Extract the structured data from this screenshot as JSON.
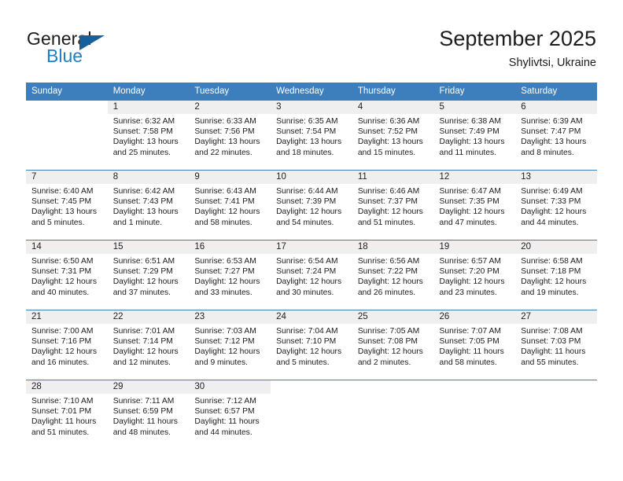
{
  "brand": {
    "name_part1": "General",
    "name_part2": "Blue",
    "logo_icon": "triangle-icon"
  },
  "header": {
    "title": "September 2025",
    "subtitle": "Shylivtsi, Ukraine"
  },
  "colors": {
    "header_blue": "#3d7ebc",
    "brand_blue": "#1e7fc4",
    "logo_blue": "#15619e",
    "number_band": "#efefef",
    "text": "#1c1c1c"
  },
  "weekday_headers": [
    "Sunday",
    "Monday",
    "Tuesday",
    "Wednesday",
    "Thursday",
    "Friday",
    "Saturday"
  ],
  "weeks": [
    [
      {
        "day": "",
        "lines": []
      },
      {
        "day": "1",
        "lines": [
          "Sunrise: 6:32 AM",
          "Sunset: 7:58 PM",
          "Daylight: 13 hours",
          "and 25 minutes."
        ]
      },
      {
        "day": "2",
        "lines": [
          "Sunrise: 6:33 AM",
          "Sunset: 7:56 PM",
          "Daylight: 13 hours",
          "and 22 minutes."
        ]
      },
      {
        "day": "3",
        "lines": [
          "Sunrise: 6:35 AM",
          "Sunset: 7:54 PM",
          "Daylight: 13 hours",
          "and 18 minutes."
        ]
      },
      {
        "day": "4",
        "lines": [
          "Sunrise: 6:36 AM",
          "Sunset: 7:52 PM",
          "Daylight: 13 hours",
          "and 15 minutes."
        ]
      },
      {
        "day": "5",
        "lines": [
          "Sunrise: 6:38 AM",
          "Sunset: 7:49 PM",
          "Daylight: 13 hours",
          "and 11 minutes."
        ]
      },
      {
        "day": "6",
        "lines": [
          "Sunrise: 6:39 AM",
          "Sunset: 7:47 PM",
          "Daylight: 13 hours",
          "and 8 minutes."
        ]
      }
    ],
    [
      {
        "day": "7",
        "lines": [
          "Sunrise: 6:40 AM",
          "Sunset: 7:45 PM",
          "Daylight: 13 hours",
          "and 5 minutes."
        ]
      },
      {
        "day": "8",
        "lines": [
          "Sunrise: 6:42 AM",
          "Sunset: 7:43 PM",
          "Daylight: 13 hours",
          "and 1 minute."
        ]
      },
      {
        "day": "9",
        "lines": [
          "Sunrise: 6:43 AM",
          "Sunset: 7:41 PM",
          "Daylight: 12 hours",
          "and 58 minutes."
        ]
      },
      {
        "day": "10",
        "lines": [
          "Sunrise: 6:44 AM",
          "Sunset: 7:39 PM",
          "Daylight: 12 hours",
          "and 54 minutes."
        ]
      },
      {
        "day": "11",
        "lines": [
          "Sunrise: 6:46 AM",
          "Sunset: 7:37 PM",
          "Daylight: 12 hours",
          "and 51 minutes."
        ]
      },
      {
        "day": "12",
        "lines": [
          "Sunrise: 6:47 AM",
          "Sunset: 7:35 PM",
          "Daylight: 12 hours",
          "and 47 minutes."
        ]
      },
      {
        "day": "13",
        "lines": [
          "Sunrise: 6:49 AM",
          "Sunset: 7:33 PM",
          "Daylight: 12 hours",
          "and 44 minutes."
        ]
      }
    ],
    [
      {
        "day": "14",
        "lines": [
          "Sunrise: 6:50 AM",
          "Sunset: 7:31 PM",
          "Daylight: 12 hours",
          "and 40 minutes."
        ]
      },
      {
        "day": "15",
        "lines": [
          "Sunrise: 6:51 AM",
          "Sunset: 7:29 PM",
          "Daylight: 12 hours",
          "and 37 minutes."
        ]
      },
      {
        "day": "16",
        "lines": [
          "Sunrise: 6:53 AM",
          "Sunset: 7:27 PM",
          "Daylight: 12 hours",
          "and 33 minutes."
        ]
      },
      {
        "day": "17",
        "lines": [
          "Sunrise: 6:54 AM",
          "Sunset: 7:24 PM",
          "Daylight: 12 hours",
          "and 30 minutes."
        ]
      },
      {
        "day": "18",
        "lines": [
          "Sunrise: 6:56 AM",
          "Sunset: 7:22 PM",
          "Daylight: 12 hours",
          "and 26 minutes."
        ]
      },
      {
        "day": "19",
        "lines": [
          "Sunrise: 6:57 AM",
          "Sunset: 7:20 PM",
          "Daylight: 12 hours",
          "and 23 minutes."
        ]
      },
      {
        "day": "20",
        "lines": [
          "Sunrise: 6:58 AM",
          "Sunset: 7:18 PM",
          "Daylight: 12 hours",
          "and 19 minutes."
        ]
      }
    ],
    [
      {
        "day": "21",
        "lines": [
          "Sunrise: 7:00 AM",
          "Sunset: 7:16 PM",
          "Daylight: 12 hours",
          "and 16 minutes."
        ]
      },
      {
        "day": "22",
        "lines": [
          "Sunrise: 7:01 AM",
          "Sunset: 7:14 PM",
          "Daylight: 12 hours",
          "and 12 minutes."
        ]
      },
      {
        "day": "23",
        "lines": [
          "Sunrise: 7:03 AM",
          "Sunset: 7:12 PM",
          "Daylight: 12 hours",
          "and 9 minutes."
        ]
      },
      {
        "day": "24",
        "lines": [
          "Sunrise: 7:04 AM",
          "Sunset: 7:10 PM",
          "Daylight: 12 hours",
          "and 5 minutes."
        ]
      },
      {
        "day": "25",
        "lines": [
          "Sunrise: 7:05 AM",
          "Sunset: 7:08 PM",
          "Daylight: 12 hours",
          "and 2 minutes."
        ]
      },
      {
        "day": "26",
        "lines": [
          "Sunrise: 7:07 AM",
          "Sunset: 7:05 PM",
          "Daylight: 11 hours",
          "and 58 minutes."
        ]
      },
      {
        "day": "27",
        "lines": [
          "Sunrise: 7:08 AM",
          "Sunset: 7:03 PM",
          "Daylight: 11 hours",
          "and 55 minutes."
        ]
      }
    ],
    [
      {
        "day": "28",
        "lines": [
          "Sunrise: 7:10 AM",
          "Sunset: 7:01 PM",
          "Daylight: 11 hours",
          "and 51 minutes."
        ]
      },
      {
        "day": "29",
        "lines": [
          "Sunrise: 7:11 AM",
          "Sunset: 6:59 PM",
          "Daylight: 11 hours",
          "and 48 minutes."
        ]
      },
      {
        "day": "30",
        "lines": [
          "Sunrise: 7:12 AM",
          "Sunset: 6:57 PM",
          "Daylight: 11 hours",
          "and 44 minutes."
        ]
      },
      {
        "day": "",
        "lines": []
      },
      {
        "day": "",
        "lines": []
      },
      {
        "day": "",
        "lines": []
      },
      {
        "day": "",
        "lines": []
      }
    ]
  ]
}
